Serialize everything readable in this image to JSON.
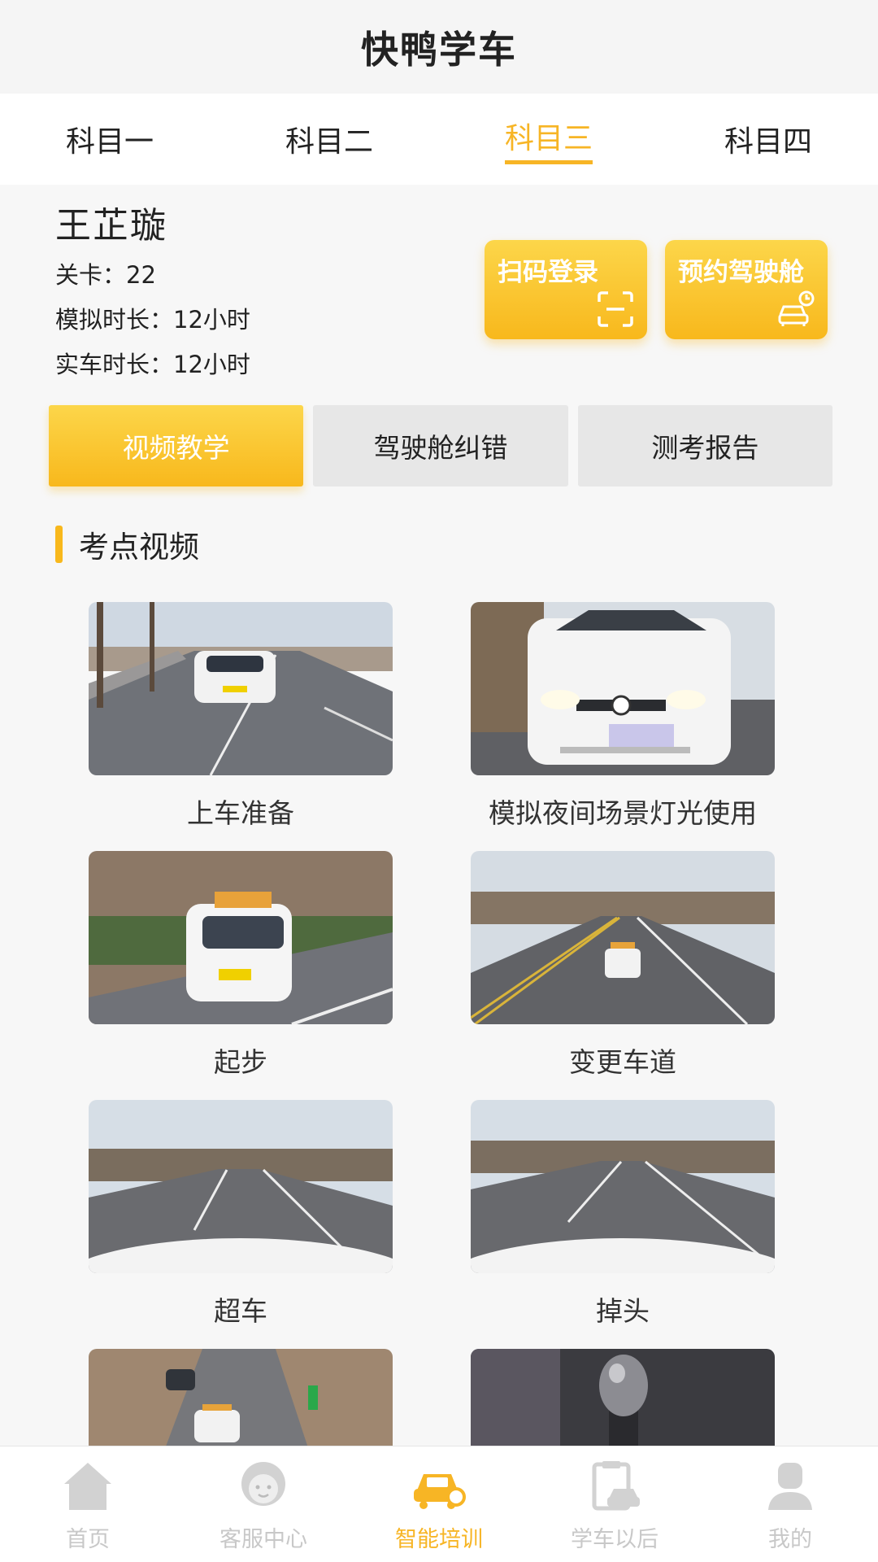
{
  "header": {
    "title": "快鸭学车"
  },
  "tabs": [
    {
      "label": "科目一",
      "active": false
    },
    {
      "label": "科目二",
      "active": false
    },
    {
      "label": "科目三",
      "active": true
    },
    {
      "label": "科目四",
      "active": false
    }
  ],
  "profile": {
    "name": "王芷璇",
    "level": "关卡：22",
    "sim_time": "模拟时长：12小时",
    "real_time": "实车时长：12小时"
  },
  "actions": {
    "scan_login": "扫码登录",
    "book_cabin": "预约驾驶舱"
  },
  "segments": [
    {
      "label": "视频教学",
      "active": true
    },
    {
      "label": "驾驶舱纠错",
      "active": false
    },
    {
      "label": "测考报告",
      "active": false
    }
  ],
  "section": {
    "title": "考点视频"
  },
  "videos": [
    {
      "caption": "上车准备"
    },
    {
      "caption": "模拟夜间场景灯光使用"
    },
    {
      "caption": "起步"
    },
    {
      "caption": "变更车道"
    },
    {
      "caption": "超车"
    },
    {
      "caption": "掉头"
    },
    {
      "caption": ""
    },
    {
      "caption": ""
    }
  ],
  "bottom_nav": [
    {
      "label": "首页",
      "icon": "home-icon",
      "active": false
    },
    {
      "label": "客服中心",
      "icon": "customer-service-icon",
      "active": false
    },
    {
      "label": "智能培训",
      "icon": "smart-training-icon",
      "active": true
    },
    {
      "label": "学车以后",
      "icon": "after-learning-icon",
      "active": false
    },
    {
      "label": "我的",
      "icon": "profile-icon",
      "active": false
    }
  ],
  "colors": {
    "accent": "#f7b525",
    "inactive": "#c8c8c8"
  }
}
